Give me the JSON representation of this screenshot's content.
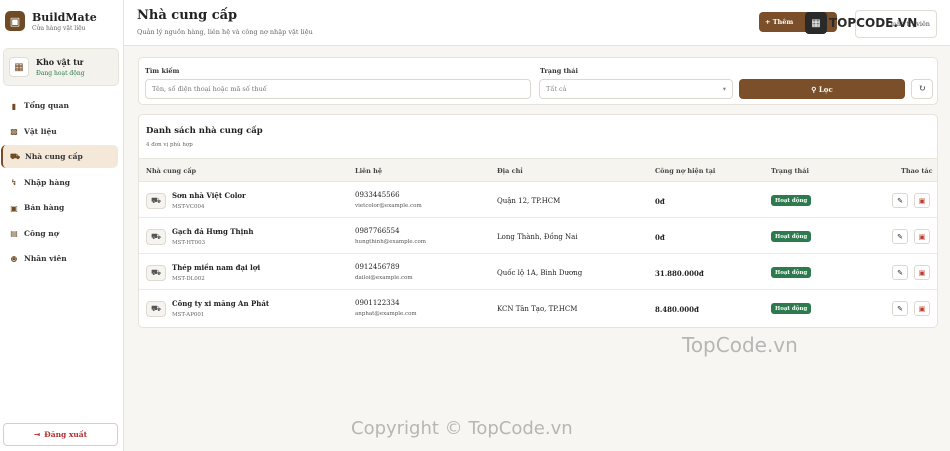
{
  "sidebar": {
    "brand_name": "BuildMate",
    "brand_sub": "Cửa hàng vật liệu",
    "store_name": "Kho vật tư",
    "store_status": "Đang hoạt động",
    "items": [
      {
        "label": "Tổng quan",
        "icon": "chart-icon"
      },
      {
        "label": "Vật liệu",
        "icon": "boxes-icon"
      },
      {
        "label": "Nhà cung cấp",
        "icon": "truck-icon"
      },
      {
        "label": "Nhập hàng",
        "icon": "dolly-icon"
      },
      {
        "label": "Bán hàng",
        "icon": "cart-icon"
      },
      {
        "label": "Công nợ",
        "icon": "document-icon"
      },
      {
        "label": "Nhân viên",
        "icon": "users-icon"
      }
    ],
    "active_index": 2,
    "logout": "Đăng xuất"
  },
  "header": {
    "title": "Nhà cung cấp",
    "subtitle": "Quản lý nguồn hàng, liên hệ và công nợ nhập vật liệu",
    "add_button": "Thêm",
    "user_button": "Quản trị viên"
  },
  "filters": {
    "search_label": "Tìm kiếm",
    "search_placeholder": "Tên, số điện thoại hoặc mã số thuế",
    "status_label": "Trạng thái",
    "status_value": "Tất cả",
    "filter_button": "Lọc"
  },
  "list": {
    "title": "Danh sách nhà cung cấp",
    "count": "4 đơn vị phù hợp",
    "columns": [
      "Nhà cung cấp",
      "Liên hệ",
      "Địa chỉ",
      "Công nợ hiện tại",
      "Trạng thái",
      "Thao tác"
    ],
    "rows": [
      {
        "name": "Sơn nhà Việt Color",
        "code": "MST-VC004",
        "phone": "0933445566",
        "email": "vietcolor@example.com",
        "address": "Quận 12, TP.HCM",
        "debt": "0đ",
        "status": "Hoạt động"
      },
      {
        "name": "Gạch đá Hưng Thịnh",
        "code": "MST-HT003",
        "phone": "0987766554",
        "email": "hungthinh@example.com",
        "address": "Long Thành, Đồng Nai",
        "debt": "0đ",
        "status": "Hoạt động"
      },
      {
        "name": "Thép miền nam đại lợi",
        "code": "MST-DL002",
        "phone": "0912456789",
        "email": "dailoi@example.com",
        "address": "Quốc lộ 1A, Bình Dương",
        "debt": "31.880.000đ",
        "status": "Hoạt động"
      },
      {
        "name": "Công ty xi măng An Phát",
        "code": "MST-AP001",
        "phone": "0901122334",
        "email": "anphat@example.com",
        "address": "KCN Tân Tạo, TP.HCM",
        "debt": "8.480.000đ",
        "status": "Hoạt động"
      }
    ]
  },
  "watermarks": {
    "logo": "TOPCODE.VN",
    "center": "TopCode.vn",
    "copyright": "Copyright © TopCode.vn"
  },
  "colors": {
    "accent": "#7a4f2a",
    "status_active": "#2c7a4e",
    "danger": "#c0392b"
  }
}
